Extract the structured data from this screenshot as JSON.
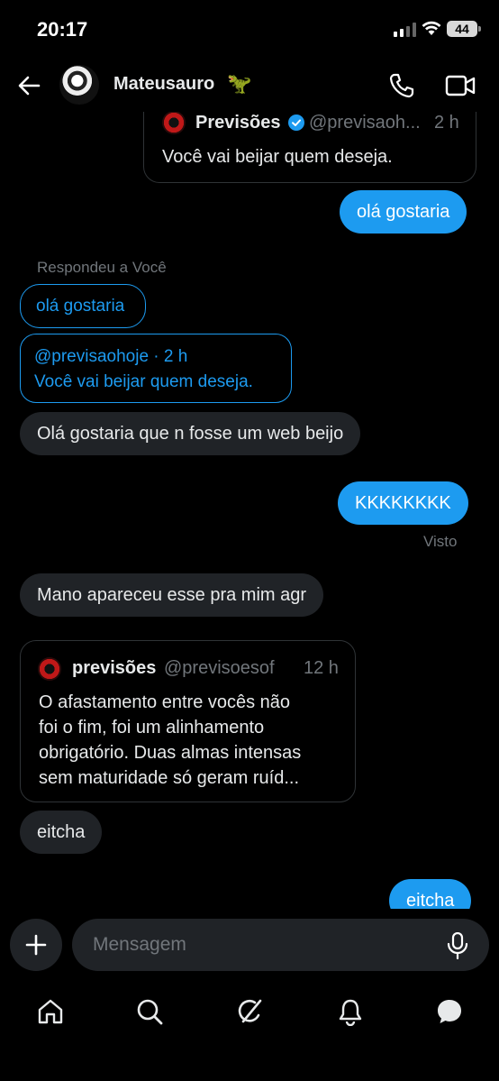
{
  "status": {
    "time": "20:17",
    "battery": "44"
  },
  "header": {
    "name": "Mateusauro",
    "emoji": "🦖"
  },
  "chat": {
    "quote_top": {
      "name": "Previsões",
      "handle": "@previsaoh...",
      "time": "2 h",
      "text": "Você vai beijar quem deseja."
    },
    "msg1": "olá gostaria",
    "reply_label": "Respondeu a Você",
    "reply_quote": "olá gostaria",
    "reply_card": {
      "meta": "@previsaohoje · 2 h",
      "text": "Você vai beijar quem deseja."
    },
    "msg2": "Olá gostaria que n fosse um web beijo",
    "msg3": "KKKKKKKK",
    "seen": "Visto",
    "msg4": "Mano apareceu esse pra mim agr",
    "quote2": {
      "name": "previsões",
      "handle": "@previsoesof",
      "time": "12 h",
      "lines": [
        "O afastamento entre vocês não",
        "foi o fim, foi um alinhamento",
        "obrigatório. Duas almas intensas",
        "sem maturidade só geram ruíd..."
      ]
    },
    "msg5": "eitcha",
    "msg6": "eitcha"
  },
  "compose": {
    "placeholder": "Mensagem"
  },
  "nav": [
    "home-icon",
    "search-icon",
    "grok-icon",
    "notifications-icon",
    "messages-icon"
  ],
  "colors": {
    "accent": "#1d9bf0",
    "bubble_recv": "#202327",
    "muted": "#71767b"
  }
}
